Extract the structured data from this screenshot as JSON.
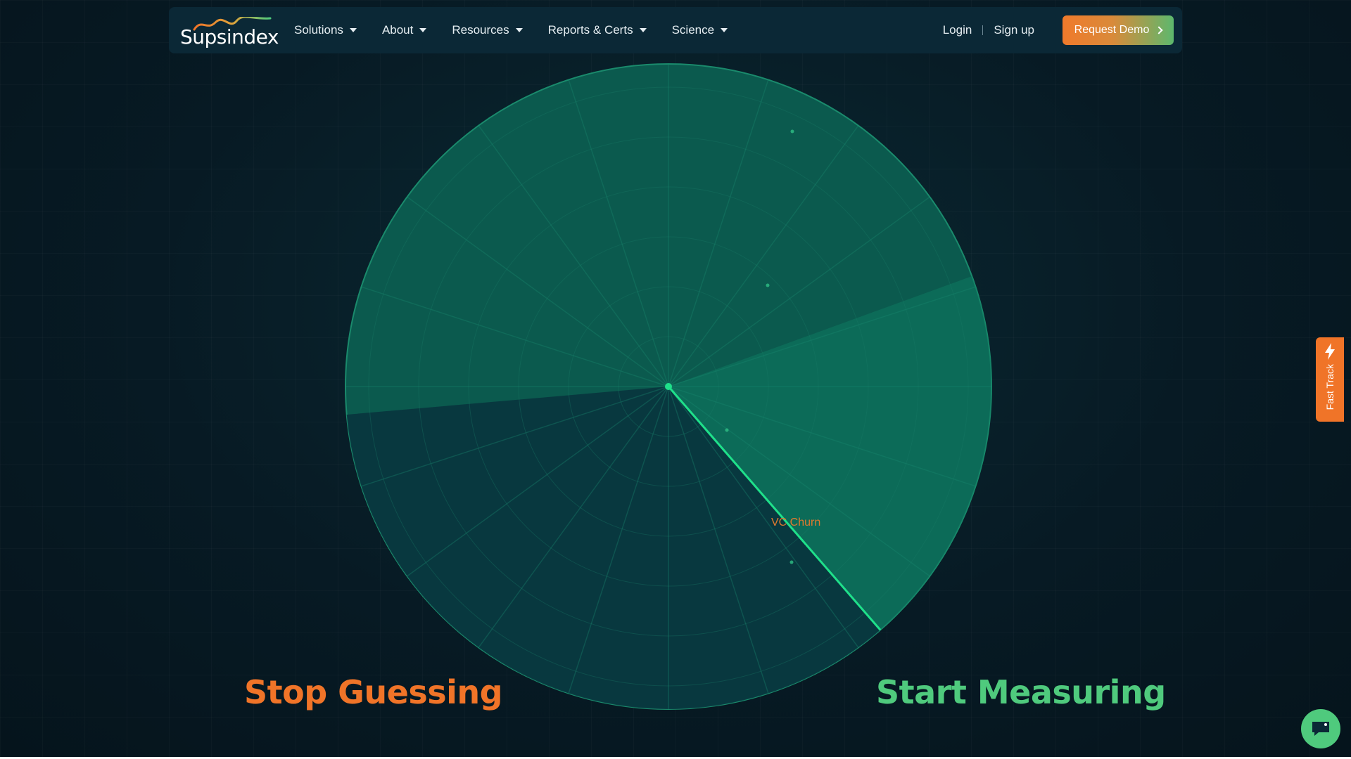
{
  "nav": {
    "logo_text": "Supsindex",
    "menu": [
      {
        "label": "Solutions"
      },
      {
        "label": "About"
      },
      {
        "label": "Resources"
      },
      {
        "label": "Reports & Certs"
      },
      {
        "label": "Science"
      }
    ],
    "login": "Login",
    "signup": "Sign up",
    "demo_button": "Request Demo"
  },
  "radar": {
    "label": "VC Churn",
    "colors": {
      "fill": "#0b5a4e",
      "sweep": "#0e7a60",
      "line": "#1fe08a",
      "accent_text": "#e07a2e"
    }
  },
  "headlines": {
    "left": "Stop Guessing",
    "right": "Start Measuring"
  },
  "side_tab": {
    "label": "Fast Track",
    "icon": "lightning-icon"
  },
  "chat": {
    "icon": "chat-icon"
  }
}
